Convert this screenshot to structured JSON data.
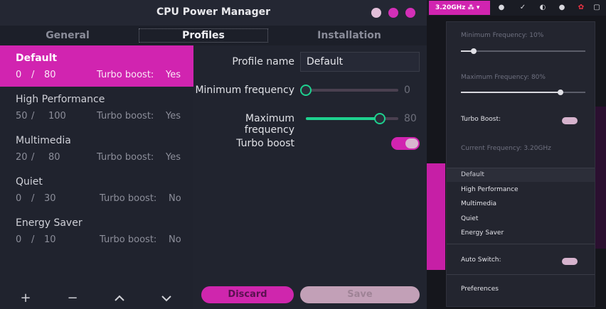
{
  "window": {
    "title": "CPU Power Manager",
    "tabs": {
      "general": "General",
      "profiles": "Profiles",
      "installation": "Installation"
    }
  },
  "profiles": [
    {
      "name": "Default",
      "min": "0",
      "max": "80",
      "turbo_label": "Turbo boost:",
      "turbo": "Yes",
      "selected": true
    },
    {
      "name": "High Performance",
      "min": "50",
      "max": "100",
      "turbo_label": "Turbo boost:",
      "turbo": "Yes"
    },
    {
      "name": "Multimedia",
      "min": "20",
      "max": "80",
      "turbo_label": "Turbo boost:",
      "turbo": "Yes"
    },
    {
      "name": "Quiet",
      "min": "0",
      "max": "30",
      "turbo_label": "Turbo boost:",
      "turbo": "No"
    },
    {
      "name": "Energy Saver",
      "min": "0",
      "max": "10",
      "turbo_label": "Turbo boost:",
      "turbo": "No"
    }
  ],
  "list_toolbar": {
    "add": "+",
    "remove": "−",
    "up": "⌃",
    "down": "⌄"
  },
  "editor": {
    "profile_name_label": "Profile name",
    "profile_name_value": "Default",
    "min_freq_label": "Minimum frequency",
    "min_freq_value": "0",
    "min_freq_percent": 0,
    "max_freq_label": "Maximum frequency",
    "max_freq_value": "80",
    "max_freq_percent": 80,
    "turbo_label": "Turbo boost",
    "turbo_on": true,
    "revert": "Discard",
    "save": "Save"
  },
  "topbar": {
    "cpu_indicator": "3.20GHz ⁂ ▾"
  },
  "indicator_menu": {
    "min_freq_label": "Minimum Frequency:  10%",
    "min_freq_percent": 10,
    "max_freq_label": "Maximum Frequency:  80%",
    "max_freq_percent": 80,
    "turbo_label": "Turbo Boost:",
    "current_freq": "Current Frequency:  3.20GHz",
    "profiles": [
      "Default",
      "High Performance",
      "Multimedia",
      "Quiet",
      "Energy Saver"
    ],
    "auto_switch_label": "Auto Switch:",
    "preferences": "Preferences"
  },
  "colors": {
    "accent": "#d124b0",
    "slider": "#1ed18f",
    "background": "#21242f"
  }
}
